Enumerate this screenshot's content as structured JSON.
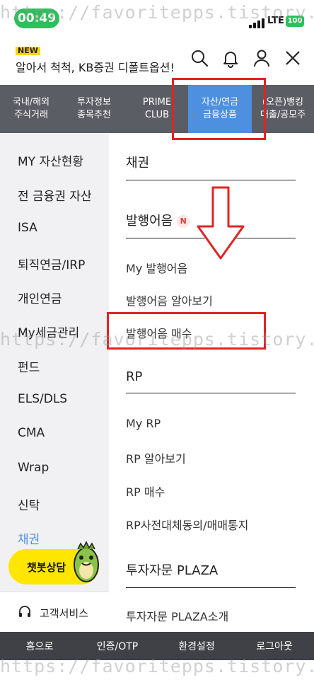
{
  "status_bar": {
    "time": "00:49",
    "network": "LTE",
    "battery": "100"
  },
  "header": {
    "new_badge": "NEW",
    "title": "알아서 척척, KB증권 디폴트옵션!",
    "icons": [
      "search-icon",
      "bell-icon",
      "user-icon",
      "close-icon"
    ]
  },
  "tabs": [
    {
      "line1": "국내/해외",
      "line2": "주식거래"
    },
    {
      "line1": "투자정보",
      "line2": "종목추천"
    },
    {
      "line1": "PRIME",
      "line2": "CLUB"
    },
    {
      "line1": "자산/연금",
      "line2": "금융상품"
    },
    {
      "line1": "(오픈)뱅킹",
      "line2": "대출/공모주"
    }
  ],
  "active_tab": 3,
  "left_menu": {
    "items": [
      "MY 자산현황",
      "전 금융권 자산",
      "ISA",
      "퇴직연금/IRP",
      "개인연금",
      "My세금관리",
      "펀드",
      "ELS/DLS",
      "CMA",
      "Wrap",
      "신탁",
      "채권"
    ],
    "active_index": 11,
    "chatbot_label": "챗봇상담",
    "support_label": "고객서비스"
  },
  "right_menu": {
    "sections": [
      {
        "title": "채권",
        "items": []
      },
      {
        "title": "발행어음",
        "badge": "N",
        "items": [
          "My 발행어음",
          "발행어음 알아보기",
          "발행어음 매수"
        ]
      },
      {
        "title": "RP",
        "items": [
          "My RP",
          "RP 알아보기",
          "RP 매수",
          "RP사전대체동의/매매통지"
        ]
      },
      {
        "title": "투자자문 PLAZA",
        "items": [
          "투자자문 PLAZA소개"
        ]
      }
    ]
  },
  "bottom_bar": [
    "홈으로",
    "인증/OTP",
    "환경설정",
    "로그아웃"
  ],
  "watermark": "https://favoritepps.tistory.com",
  "colors": {
    "accent_blue": "#4d90e0",
    "annotation_red": "#e02424",
    "chatbot_yellow": "#ffe600",
    "tab_bg": "#5a5d63"
  }
}
